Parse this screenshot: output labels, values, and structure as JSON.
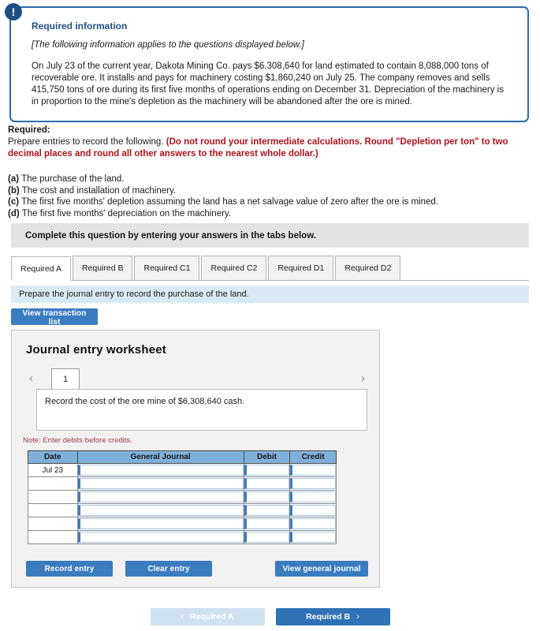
{
  "info": {
    "icon": "exclamation-icon",
    "title": "Required information",
    "subtitle": "[The following information applies to the questions displayed below.]",
    "body": "On July 23 of the current year, Dakota Mining Co. pays $6,308,640 for land estimated to contain 8,088,000 tons of recoverable ore. It installs and pays for machinery costing $1,860,240 on July 25. The company removes and sells 415,750 tons of ore during its first five months of operations ending on December 31. Depreciation of the machinery is in proportion to the mine's depletion as the machinery will be abandoned after the ore is mined."
  },
  "required": {
    "label": "Required:",
    "lead": "Prepare entries to record the following.",
    "red_note": "(Do not round your intermediate calculations. Round \"Depletion per ton\" to two decimal places and round all other answers to the nearest whole dollar.)",
    "items": [
      {
        "marker": "(a)",
        "text": "The purchase of the land."
      },
      {
        "marker": "(b)",
        "text": "The cost and installation of machinery."
      },
      {
        "marker": "(c)",
        "text": "The first five months' depletion assuming the land has a net salvage value of zero after the ore is mined."
      },
      {
        "marker": "(d)",
        "text": "The first five months' depreciation on the machinery."
      }
    ]
  },
  "complete_bar": {
    "text": "Complete this question by entering your answers in the tabs below."
  },
  "tabs": [
    {
      "label": "Required A",
      "active": true
    },
    {
      "label": "Required B",
      "active": false
    },
    {
      "label": "Required C1",
      "active": false
    },
    {
      "label": "Required C2",
      "active": false
    },
    {
      "label": "Required D1",
      "active": false
    },
    {
      "label": "Required D2",
      "active": false
    }
  ],
  "prompt": {
    "text": "Prepare the journal entry to record the purchase of the land."
  },
  "toolbar": {
    "view_transaction_list": "View transaction list"
  },
  "worksheet": {
    "title": "Journal entry worksheet",
    "pager": {
      "prev_icon": "chevron-left-icon",
      "next_icon": "chevron-right-icon",
      "current_page": "1"
    },
    "description": "Record the cost of the ore mine of $6,308,640 cash.",
    "note": "Note: Enter debits before credits.",
    "table": {
      "headers": [
        "Date",
        "General Journal",
        "Debit",
        "Credit"
      ],
      "rows": [
        {
          "date": "Jul 23",
          "general_journal": "",
          "debit": "",
          "credit": ""
        },
        {
          "date": "",
          "general_journal": "",
          "debit": "",
          "credit": ""
        },
        {
          "date": "",
          "general_journal": "",
          "debit": "",
          "credit": ""
        },
        {
          "date": "",
          "general_journal": "",
          "debit": "",
          "credit": ""
        },
        {
          "date": "",
          "general_journal": "",
          "debit": "",
          "credit": ""
        },
        {
          "date": "",
          "general_journal": "",
          "debit": "",
          "credit": ""
        }
      ]
    },
    "buttons": {
      "record_entry": "Record entry",
      "clear_entry": "Clear entry",
      "view_general_journal": "View general journal"
    }
  },
  "bottom_nav": {
    "prev_label": "Required A",
    "prev_icon": "chevron-left-icon",
    "next_label": "Required B",
    "next_icon": "chevron-right-icon"
  },
  "colors": {
    "accent_blue": "#3a7cc0",
    "callout_border": "#2d6ca8",
    "icon_navy": "#1f4f82",
    "red_note": "#b3121d",
    "prompt_bg": "#daeaf5",
    "table_header_bg": "#7fb0db",
    "gray_bar": "#e2e2e2"
  }
}
